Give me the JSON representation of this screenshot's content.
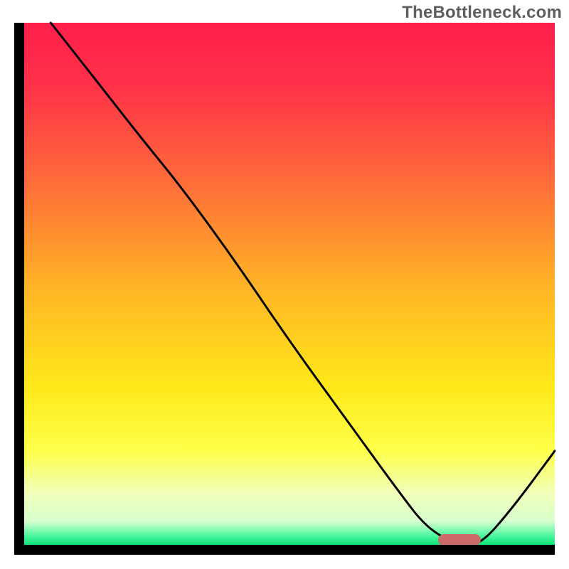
{
  "watermark": "TheBottleneck.com",
  "colors": {
    "axis": "#000000",
    "curve": "#000000",
    "marker": "#cb6a69",
    "gradient_stops": [
      {
        "pos": 0.0,
        "color": "#ff1f4b"
      },
      {
        "pos": 0.12,
        "color": "#ff3149"
      },
      {
        "pos": 0.3,
        "color": "#ff6a3a"
      },
      {
        "pos": 0.5,
        "color": "#ffb226"
      },
      {
        "pos": 0.7,
        "color": "#ffe91a"
      },
      {
        "pos": 0.82,
        "color": "#fdff4a"
      },
      {
        "pos": 0.9,
        "color": "#f1ffb8"
      },
      {
        "pos": 0.955,
        "color": "#d7ffcf"
      },
      {
        "pos": 0.985,
        "color": "#41f59a"
      },
      {
        "pos": 1.0,
        "color": "#11e27a"
      }
    ]
  },
  "chart_data": {
    "type": "line",
    "title": "",
    "xlabel": "",
    "ylabel": "",
    "xlim": [
      0,
      100
    ],
    "ylim": [
      0,
      100
    ],
    "grid": false,
    "legend": false,
    "series": [
      {
        "name": "bottleneck-curve",
        "x": [
          5,
          12,
          22,
          30,
          40,
          50,
          60,
          70,
          76,
          82,
          86,
          92,
          100
        ],
        "y": [
          100,
          91,
          78,
          68,
          54,
          39,
          25,
          11,
          3,
          0,
          0,
          7,
          18
        ]
      }
    ],
    "annotations": [
      {
        "name": "optimal-range-marker",
        "x_start": 78,
        "x_end": 86,
        "y": 1
      }
    ]
  }
}
